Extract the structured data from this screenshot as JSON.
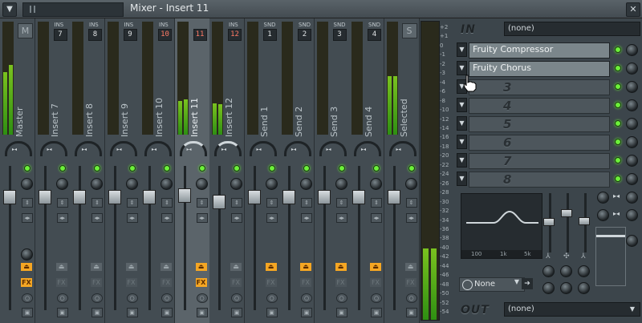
{
  "window": {
    "title": "Mixer - Insert 11"
  },
  "strips": [
    {
      "name": "Master",
      "badge": "",
      "number": "",
      "selected": false,
      "fx_active": true,
      "route_active": true,
      "meter_left": 0.55,
      "meter_right": 0.62
    },
    {
      "name": "Insert 7",
      "badge": "INS",
      "number": "7",
      "selected": false,
      "fx_active": false,
      "route_active": false,
      "meter_left": 0,
      "meter_right": 0
    },
    {
      "name": "Insert 8",
      "badge": "INS",
      "number": "8",
      "selected": false,
      "fx_active": false,
      "route_active": false,
      "meter_left": 0,
      "meter_right": 0
    },
    {
      "name": "Insert 9",
      "badge": "INS",
      "number": "9",
      "selected": false,
      "fx_active": false,
      "route_active": false,
      "meter_left": 0,
      "meter_right": 0
    },
    {
      "name": "Insert 10",
      "badge": "INS",
      "number": "10",
      "selected": false,
      "fx_active": false,
      "route_active": false,
      "meter_left": 0,
      "meter_right": 0
    },
    {
      "name": "Insert 11",
      "badge": "",
      "number": "11",
      "selected": true,
      "fx_active": true,
      "route_active": true,
      "meter_left": 0.3,
      "meter_right": 0.31
    },
    {
      "name": "Insert 12",
      "badge": "INS",
      "number": "12",
      "selected": false,
      "fx_active": false,
      "route_active": false,
      "meter_left": 0.28,
      "meter_right": 0.27
    },
    {
      "name": "Send 1",
      "badge": "SND",
      "number": "1",
      "selected": false,
      "fx_active": false,
      "route_active": true,
      "meter_left": 0,
      "meter_right": 0
    },
    {
      "name": "Send 2",
      "badge": "SND",
      "number": "2",
      "selected": false,
      "fx_active": false,
      "route_active": true,
      "meter_left": 0,
      "meter_right": 0
    },
    {
      "name": "Send 3",
      "badge": "SND",
      "number": "3",
      "selected": false,
      "fx_active": false,
      "route_active": true,
      "meter_left": 0,
      "meter_right": 0
    },
    {
      "name": "Send 4",
      "badge": "SND",
      "number": "4",
      "selected": false,
      "fx_active": false,
      "route_active": true,
      "meter_left": 0,
      "meter_right": 0
    },
    {
      "name": "Selected",
      "badge": "",
      "number": "",
      "selected": false,
      "fx_active": false,
      "route_active": false,
      "meter_left": 0.52,
      "meter_right": 0.52
    }
  ],
  "fx_label": "FX",
  "meter_scale": [
    "+2",
    "+1",
    "0",
    "-1",
    "-2",
    "-3",
    "-4",
    "-6",
    "-8",
    "-10",
    "-12",
    "-14",
    "-16",
    "-18",
    "-20",
    "-22",
    "-24",
    "-26",
    "-28",
    "-30",
    "-32",
    "-34",
    "-36",
    "-38",
    "-40",
    "-42",
    "-44",
    "-46",
    "-48",
    "-50",
    "-52",
    "-54"
  ],
  "master_meter": {
    "left": 0.24,
    "right": 0.24
  },
  "panel": {
    "in_label": "IN",
    "in_value": "(none)",
    "slots": [
      {
        "label": "Fruity Compressor",
        "ghost": ""
      },
      {
        "label": "Fruity Chorus",
        "ghost": ""
      },
      {
        "label": "",
        "ghost": "3"
      },
      {
        "label": "",
        "ghost": "4"
      },
      {
        "label": "",
        "ghost": "5"
      },
      {
        "label": "",
        "ghost": "6"
      },
      {
        "label": "",
        "ghost": "7"
      },
      {
        "label": "",
        "ghost": "8"
      }
    ],
    "eq_freqs": [
      "100",
      "1k",
      "5k"
    ],
    "preset_value": "None",
    "out_label": "OUT",
    "out_value": "(none)"
  }
}
